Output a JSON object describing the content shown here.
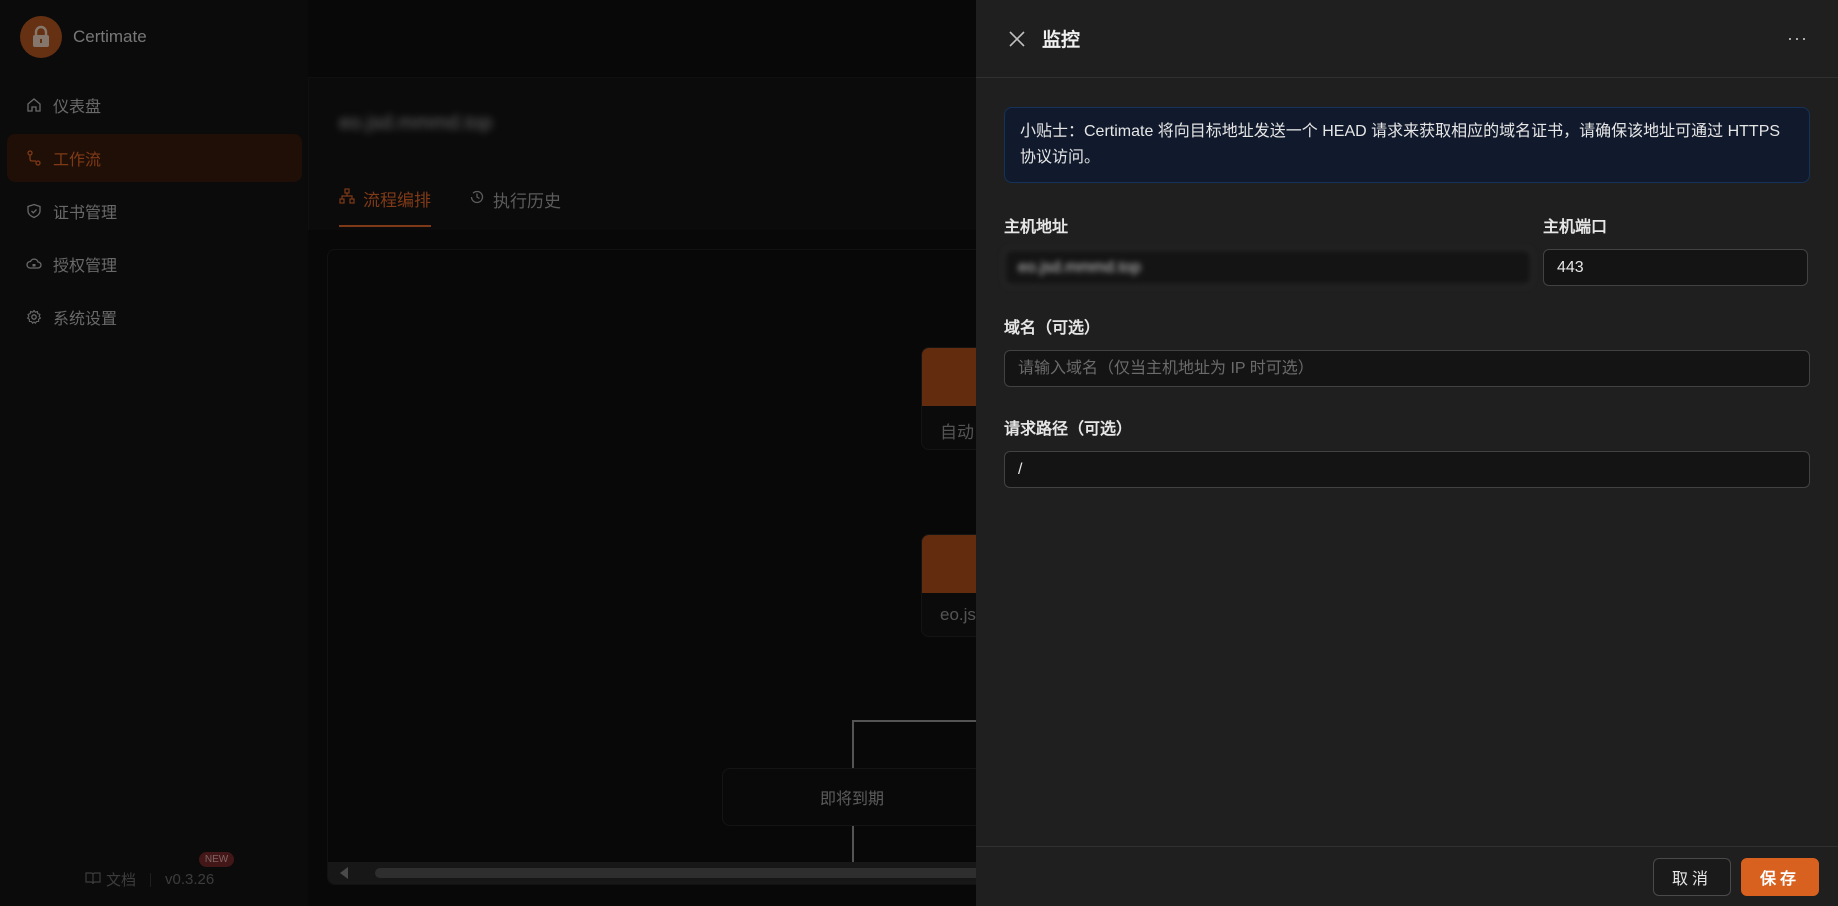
{
  "app": {
    "name": "Certimate"
  },
  "sidebar": {
    "items": [
      {
        "label": "仪表盘",
        "icon": "home-icon"
      },
      {
        "label": "工作流",
        "icon": "workflow-icon",
        "active": true
      },
      {
        "label": "证书管理",
        "icon": "shield-icon"
      },
      {
        "label": "授权管理",
        "icon": "cloud-lock-icon"
      },
      {
        "label": "系统设置",
        "icon": "gear-icon"
      }
    ],
    "footer": {
      "docs_label": "文档",
      "version": "v0.3.26",
      "new_badge": "NEW"
    }
  },
  "main": {
    "workflow_title": "eo.jsd.mmmd.top",
    "tabs": [
      {
        "label": "流程编排",
        "icon": "flow-icon",
        "active": true
      },
      {
        "label": "执行历史",
        "icon": "history-icon"
      }
    ],
    "nodes": [
      {
        "label": "自动"
      },
      {
        "label": "eo.jsd"
      }
    ],
    "condition": "即将到期"
  },
  "drawer": {
    "title": "监控",
    "more_label": "···",
    "tip": "小贴士：Certimate 将向目标地址发送一个 HEAD 请求来获取相应的域名证书，请确保该地址可通过 HTTPS 协议访问。",
    "host": {
      "label": "主机地址",
      "value": "eo.jsd.mmmd.top"
    },
    "port": {
      "label": "主机端口",
      "value": "443"
    },
    "domain": {
      "label": "域名（可选）",
      "placeholder": "请输入域名（仅当主机地址为 IP 时可选）",
      "value": ""
    },
    "path": {
      "label": "请求路径（可选）",
      "value": "/"
    },
    "cancel_label": "取消",
    "save_label": "保存"
  },
  "colors": {
    "accent": "#d8611f",
    "tip_bg": "#111a2c",
    "drawer_bg": "#1f1f1f"
  }
}
